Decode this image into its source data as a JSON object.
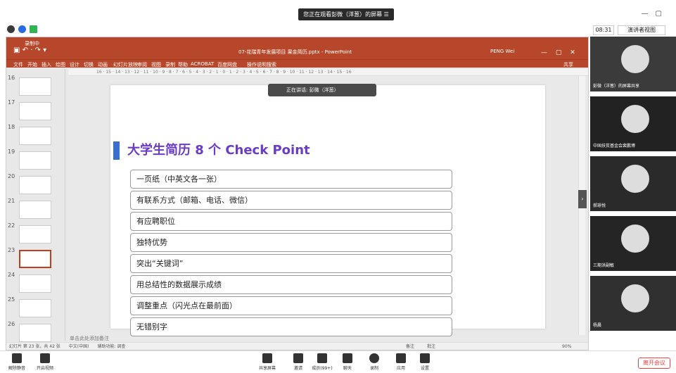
{
  "meeting": {
    "share_banner": "您正在观看彭微（洋葱）的屏幕",
    "time": "08:31",
    "view_mode": "演讲者视图",
    "speaking_tip": "正在讲话: 彭微（洋葱）",
    "leave_label": "离开会议"
  },
  "ppt": {
    "rec_label": "录制中",
    "file_title": "07-花瑞青年发展项目 果金简历.pptx - PowerPoint",
    "user": "PENG Wei",
    "share_label": "共享",
    "ribbon_tabs": [
      "文件",
      "开始",
      "插入",
      "绘图",
      "设计",
      "切换",
      "动画",
      "幻灯片放映",
      "审阅",
      "视图",
      "录制",
      "帮助",
      "ACROBAT",
      "百度网盘",
      "操作说明搜索"
    ],
    "ruler": "16 · 15 · 14 · 13 · 12 · 11 · 10 · 9 · 8 · 7 · 6 · 5 · 4 · 3 · 2 · 1 · 0 · 1 · 2 · 3 · 4 · 5 · 6 · 7 · 8 · 9 · 10 · 11 · 12 · 13 · 14 · 15 · 16",
    "thumb_numbers": [
      "16",
      "17",
      "18",
      "19",
      "20",
      "21",
      "22",
      "23",
      "24",
      "25",
      "26"
    ],
    "notes_placeholder": "单击此处添加备注",
    "status_text": "幻灯片 第 23 张，共 42 张　　中文(中国)　　辅助功能: 调查",
    "zoom_text": "90%",
    "notes_label": "备注",
    "comments_label": "批注"
  },
  "slide": {
    "title": "大学生简历 8 个 Check Point",
    "items": [
      "一页纸（中英文各一张）",
      "有联系方式（邮箱、电话、微信）",
      "有应聘职位",
      "独特优势",
      "突出“关键词”",
      "用总结性的数据展示成绩",
      "调整重点（闪光点在最前面）",
      "无错别字"
    ]
  },
  "participants": [
    {
      "name": "彭微（洋葱）的屏幕共享"
    },
    {
      "name": "中国扶贫基金会裴鹏博"
    },
    {
      "name": "郝璟悦"
    },
    {
      "name": "三期洪副敏"
    },
    {
      "name": "杨晨"
    }
  ],
  "toolbar": {
    "mute": "解除静音",
    "video": "开启视频",
    "share": "共享屏幕",
    "invite": "邀请",
    "members": "成员(99+)",
    "chat": "聊天",
    "record": "录制",
    "apps": "应用",
    "settings": "设置"
  }
}
